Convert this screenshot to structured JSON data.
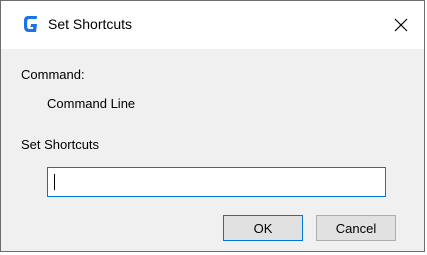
{
  "window": {
    "title": "Set Shortcuts",
    "icon": "app-logo-icon",
    "close_icon": "close-icon",
    "accent_color": "#0078d7"
  },
  "form": {
    "command_label": "Command:",
    "command_value": "Command Line",
    "shortcut_label": "Set Shortcuts",
    "shortcut_value": ""
  },
  "buttons": {
    "ok_label": "OK",
    "cancel_label": "Cancel"
  }
}
